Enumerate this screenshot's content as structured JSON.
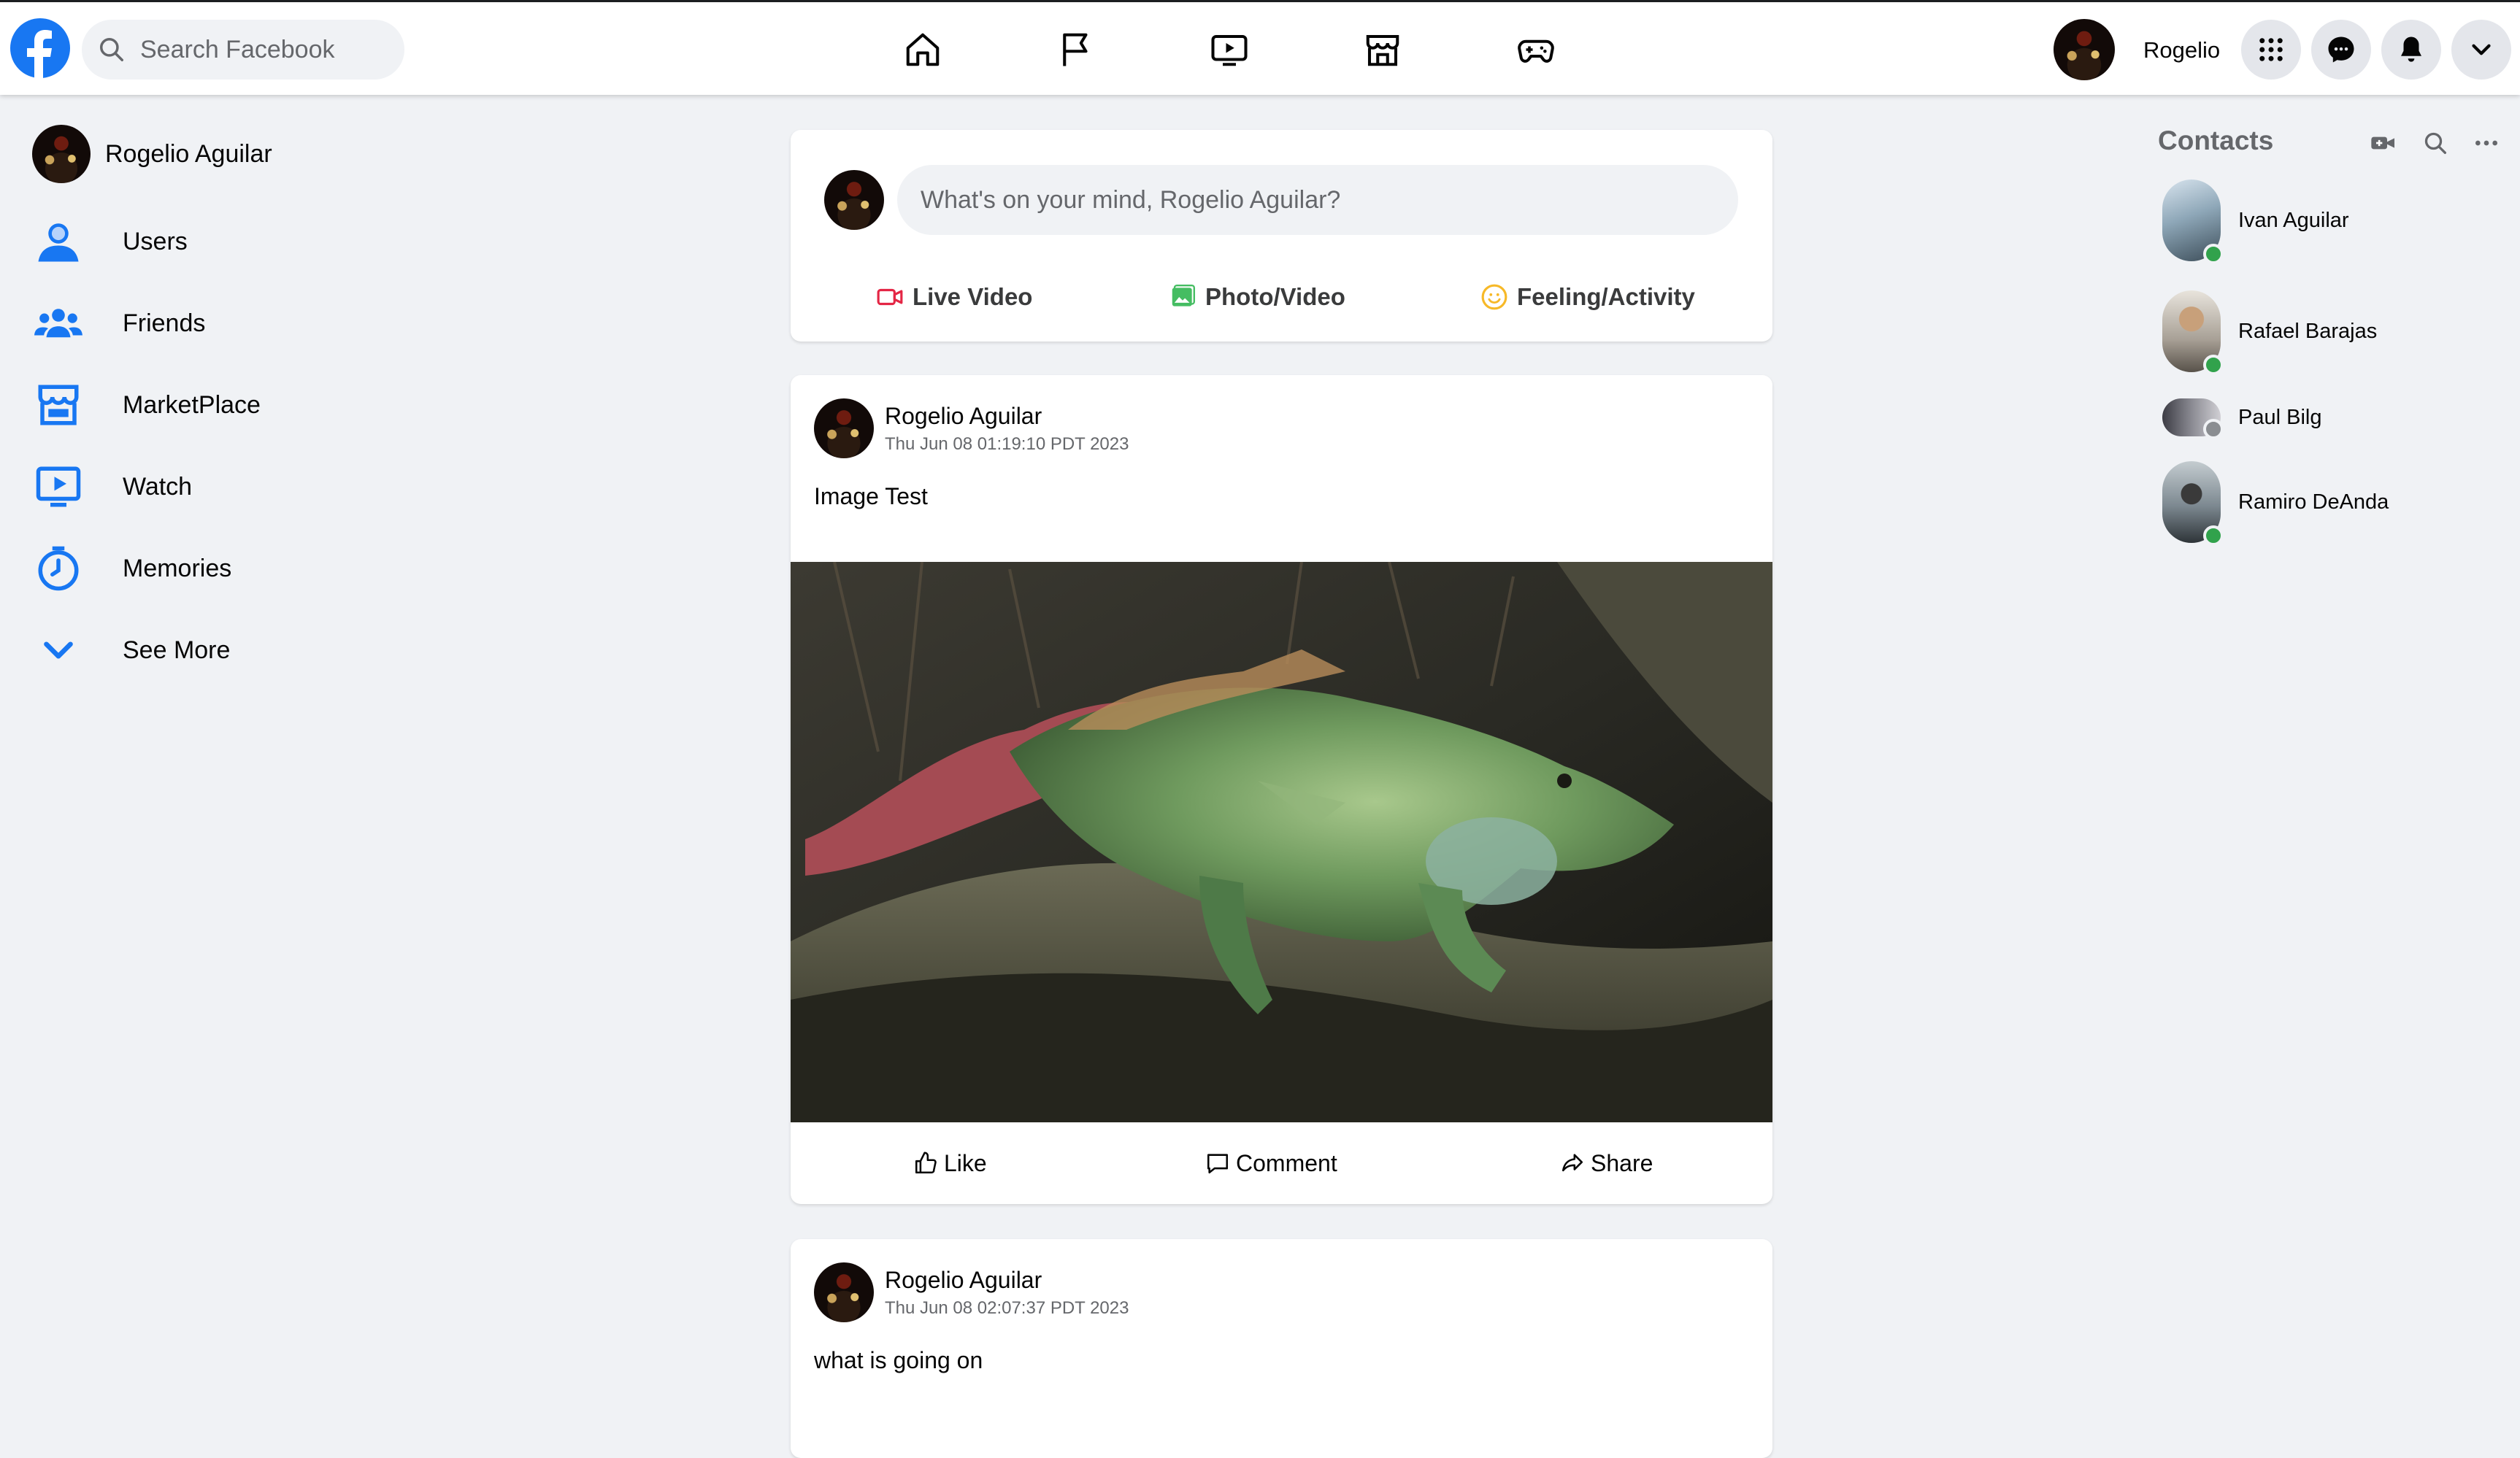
{
  "header": {
    "search_placeholder": "Search Facebook",
    "user_name": "Rogelio",
    "nav_icons": [
      "home-icon",
      "flag-icon",
      "watch-icon",
      "marketplace-icon",
      "gaming-icon"
    ],
    "right_buttons": [
      "menu-grid-icon",
      "messenger-icon",
      "notifications-icon",
      "account-chevron-icon"
    ]
  },
  "sidebar": {
    "profile_name": "Rogelio Aguilar",
    "items": [
      {
        "label": "Users",
        "icon": "user-icon"
      },
      {
        "label": "Friends",
        "icon": "friends-icon"
      },
      {
        "label": "MarketPlace",
        "icon": "marketplace-icon"
      },
      {
        "label": "Watch",
        "icon": "watch-icon"
      },
      {
        "label": "Memories",
        "icon": "memories-clock-icon"
      },
      {
        "label": "See More",
        "icon": "chevron-down-icon"
      }
    ]
  },
  "composer": {
    "placeholder": "What's on your mind, Rogelio Aguilar?",
    "actions": [
      {
        "label": "Live Video",
        "icon": "live-video-icon",
        "color": "#e42645"
      },
      {
        "label": "Photo/Video",
        "icon": "photo-icon",
        "color": "#45bd62"
      },
      {
        "label": "Feeling/Activity",
        "icon": "feeling-icon",
        "color": "#f7b928"
      }
    ]
  },
  "posts": [
    {
      "author": "Rogelio Aguilar",
      "time": "Thu Jun 08 01:19:10 PDT 2023",
      "text": "Image Test",
      "has_image": true,
      "image_subject": "green iguana on a log"
    },
    {
      "author": "Rogelio Aguilar",
      "time": "Thu Jun 08 02:07:37 PDT 2023",
      "text": "what is going on",
      "has_image": false
    }
  ],
  "post_actions": {
    "like": "Like",
    "comment": "Comment",
    "share": "Share"
  },
  "contacts": {
    "title": "Contacts",
    "tools": [
      "new-room-video-icon",
      "contacts-search-icon",
      "contacts-more-icon"
    ],
    "items": [
      {
        "name": "Ivan Aguilar",
        "online": true
      },
      {
        "name": "Rafael Barajas",
        "online": true
      },
      {
        "name": "Paul Bilg",
        "online": false
      },
      {
        "name": "Ramiro DeAnda",
        "online": true
      }
    ]
  },
  "colors": {
    "brand": "#1877f2",
    "online": "#31a24c",
    "offline": "#8a8d91",
    "background": "#f0f2f5"
  }
}
